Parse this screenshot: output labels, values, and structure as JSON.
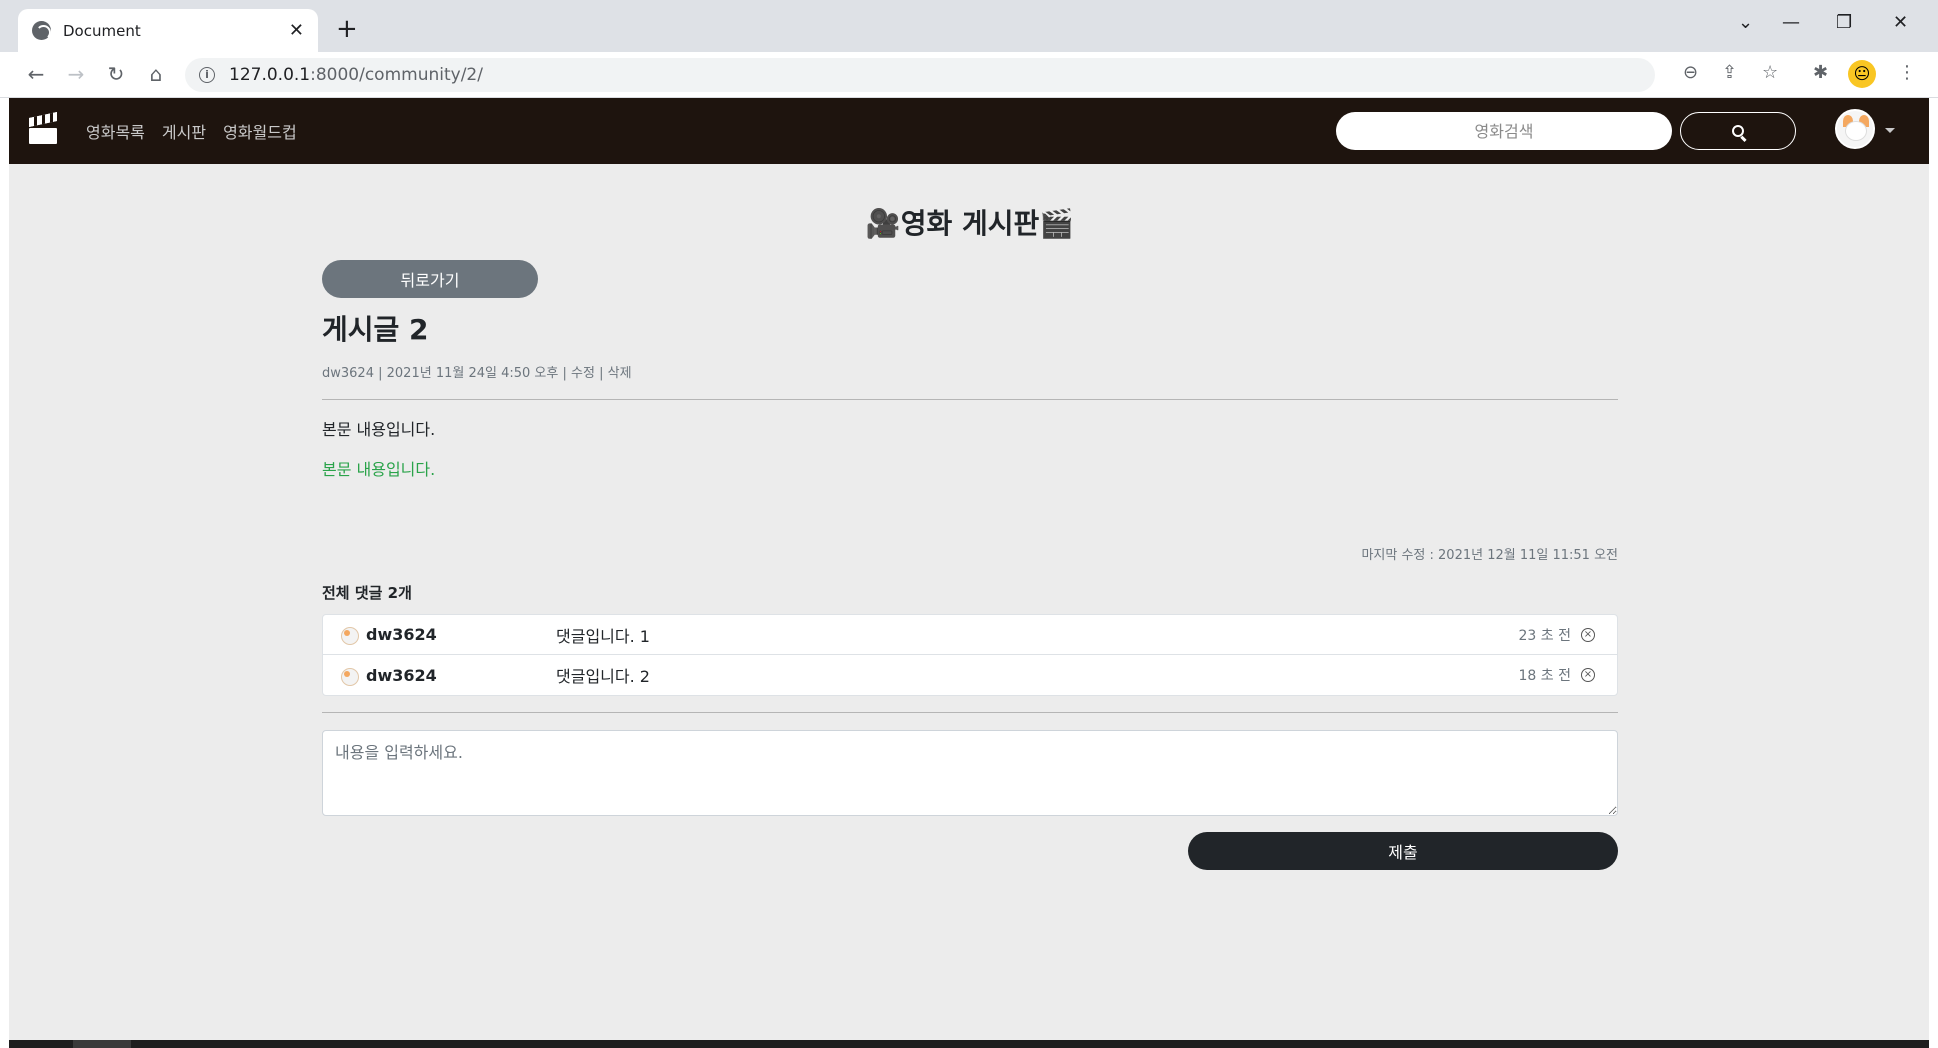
{
  "browser": {
    "tab_title": "Document",
    "tab_close": "✕",
    "new_tab": "+",
    "url_host": "127.0.0.1",
    "url_path": ":8000/community/2/",
    "controls": {
      "tab_list": "⌄",
      "minimize": "—",
      "restore": "❐",
      "close": "✕"
    },
    "nav": {
      "back": "←",
      "forward": "→",
      "reload": "↻",
      "home": "⌂"
    },
    "toolbar": {
      "zoom": "⊖",
      "share": "⇪",
      "bookmark": "☆",
      "extensions": "✱",
      "menu": "⋮",
      "profile_emoji": "😐"
    }
  },
  "site_nav": {
    "menu": [
      "영화목록",
      "게시판",
      "영화월드컵"
    ],
    "search_placeholder": "영화검색"
  },
  "page": {
    "board_title": "🎥영화 게시판🎬",
    "back_button": "뒤로가기",
    "post_title": "게시글 2",
    "meta": {
      "author": "dw3624",
      "date": "2021년 11월 24일 4:50 오후",
      "edit": "수정",
      "delete": "삭제",
      "sep": "|"
    },
    "body_line1": "본문 내용입니다.",
    "body_line2": "본문 내용입니다.",
    "body_line2_color": "#2aa34a",
    "last_modified": "마지막 수정 : 2021년 12월 11일 11:51 오전",
    "comments_title": "전체 댓글 2개",
    "comments": [
      {
        "author": "dw3624",
        "text": "댓글입니다. 1",
        "time": "23 초 전"
      },
      {
        "author": "dw3624",
        "text": "댓글입니다. 2",
        "time": "18 초 전"
      }
    ],
    "comment_placeholder": "내용을 입력하세요.",
    "submit_button": "제출"
  },
  "colors": {
    "navbar_bg": "#1e140e",
    "page_bg": "#ececec",
    "back_button_bg": "#6c757d",
    "submit_button_bg": "#212529"
  }
}
